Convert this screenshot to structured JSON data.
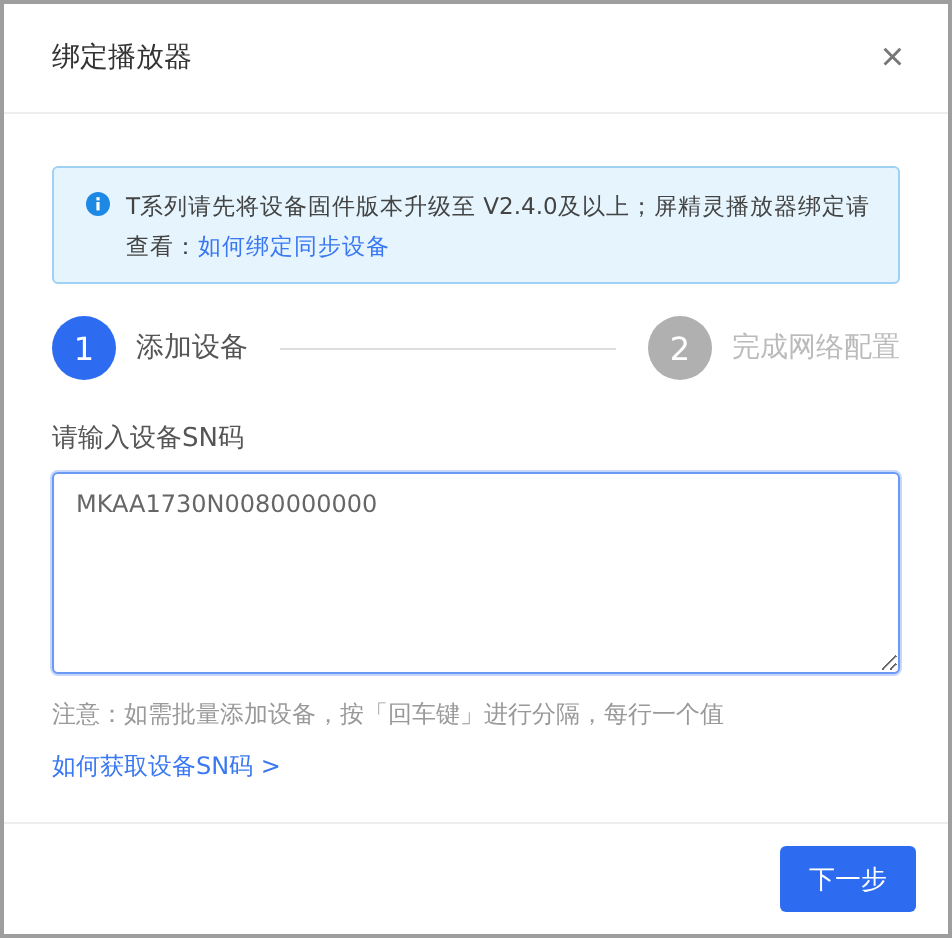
{
  "dialog": {
    "title": "绑定播放器",
    "close": "×"
  },
  "notice": {
    "text": "T系列请先将设备固件版本升级至 V2.4.0及以上；屏精灵播放器绑定请查看：",
    "link": "如何绑定同步设备"
  },
  "steps": [
    {
      "number": "1",
      "label": "添加设备",
      "selected": true
    },
    {
      "number": "2",
      "label": "完成网络配置",
      "selected": false
    }
  ],
  "sn_field": {
    "label": "请输入设备SN码",
    "value": "MKAA1730N0080000000"
  },
  "hint": "注意：如需批量添加设备，按「回车键」进行分隔，每行一个值",
  "help_link": "如何获取设备SN码 >",
  "buttons": [
    {
      "label": "下一步"
    }
  ]
}
